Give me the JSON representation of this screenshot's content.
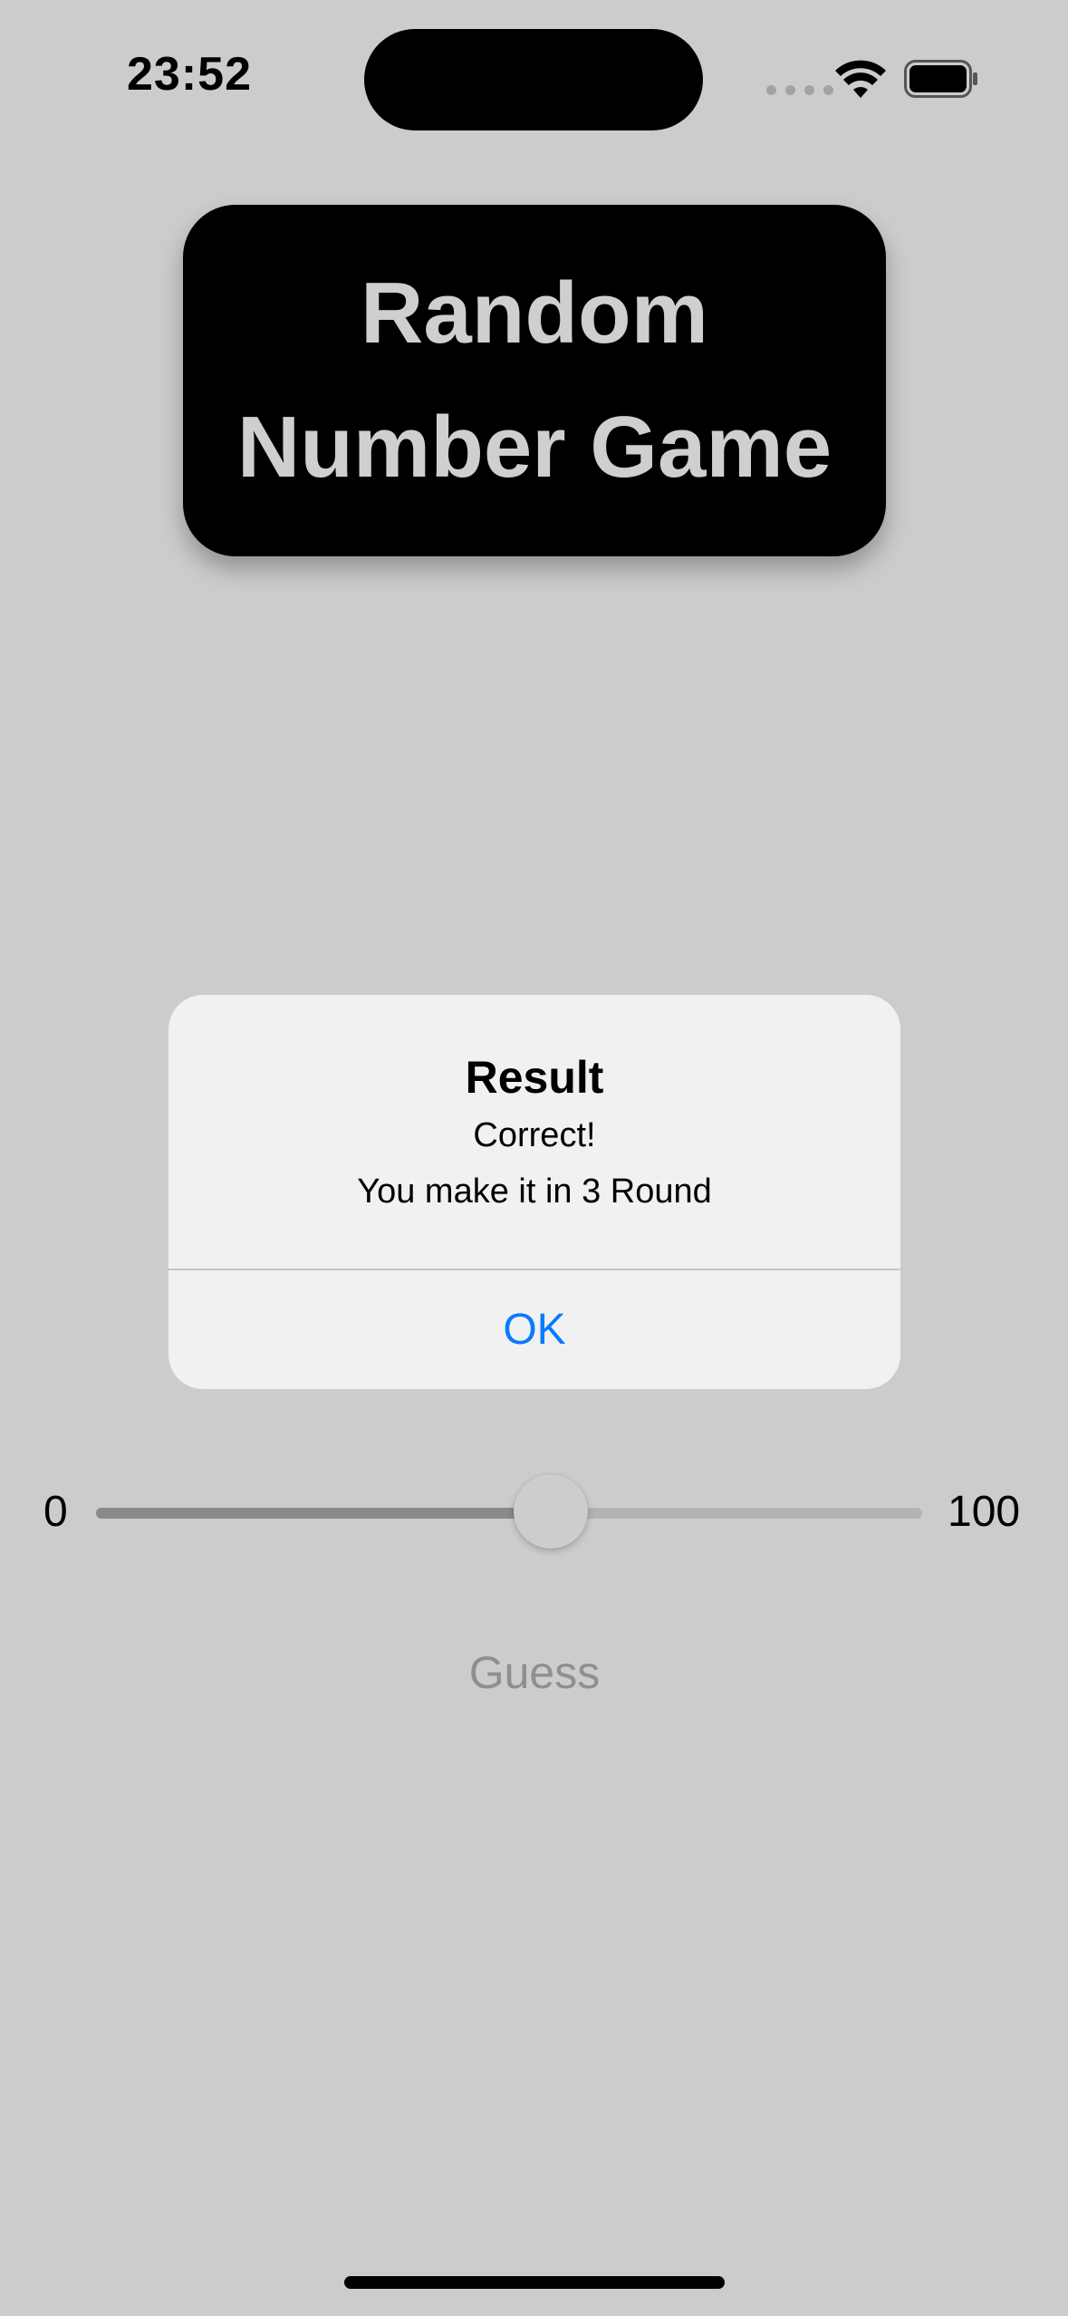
{
  "status_bar": {
    "time": "23:52",
    "icons": [
      "cellular-signal-icon",
      "wifi-icon",
      "battery-icon"
    ]
  },
  "title": {
    "line1": "Random",
    "line2": "Number Game"
  },
  "alert": {
    "title": "Result",
    "message_line1": "Correct!",
    "message_line2": "You make it in 3 Round",
    "ok_label": "OK"
  },
  "slider": {
    "min_label": "0",
    "max_label": "100",
    "min": 0,
    "max": 100,
    "value": 55
  },
  "guess_label": "Guess",
  "colors": {
    "background": "#cccccc",
    "alert_background": "#f0f1f0",
    "accent": "#0a7aff",
    "title_text": "#cfcfcf"
  }
}
